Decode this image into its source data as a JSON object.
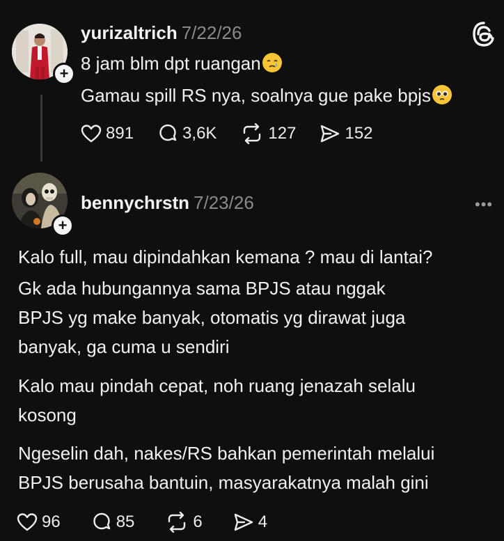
{
  "post1": {
    "username": "yurizaltrich",
    "date": "7/22/26",
    "lines": [
      "8 jam blm dpt ruangan",
      "Gamau spill RS nya, soalnya gue pake bpjs"
    ],
    "likes": "891",
    "replies": "3,6K",
    "reposts": "127",
    "shares": "152"
  },
  "post2": {
    "username": "bennychrstn",
    "date": "7/23/26",
    "lines": [
      "Kalo full, mau dipindahkan kemana ? mau di lantai?",
      "Gk ada hubungannya sama BPJS atau nggak",
      "BPJS yg make banyak, otomatis yg dirawat juga",
      "banyak, ga cuma u sendiri",
      "Kalo mau pindah cepat, noh ruang jenazah selalu",
      "kosong",
      "Ngeselin dah, nakes/RS bahkan pemerintah melalui",
      "BPJS berusaha bantuin, masyarakatnya malah gini"
    ],
    "likes": "96",
    "replies": "85",
    "reposts": "6",
    "shares": "4"
  },
  "icons": {
    "like": "heart-icon",
    "reply": "comment-icon",
    "repost": "repost-icon",
    "share": "share-icon",
    "app": "threads-logo-icon",
    "more": "more-options-icon",
    "follow": "plus-icon",
    "emoji1": "crying-face-emoji",
    "emoji2": "pleading-face-emoji"
  },
  "colors": {
    "background": "#0f0f10",
    "text": "#f3f3f3",
    "muted": "#8a8a8a"
  }
}
